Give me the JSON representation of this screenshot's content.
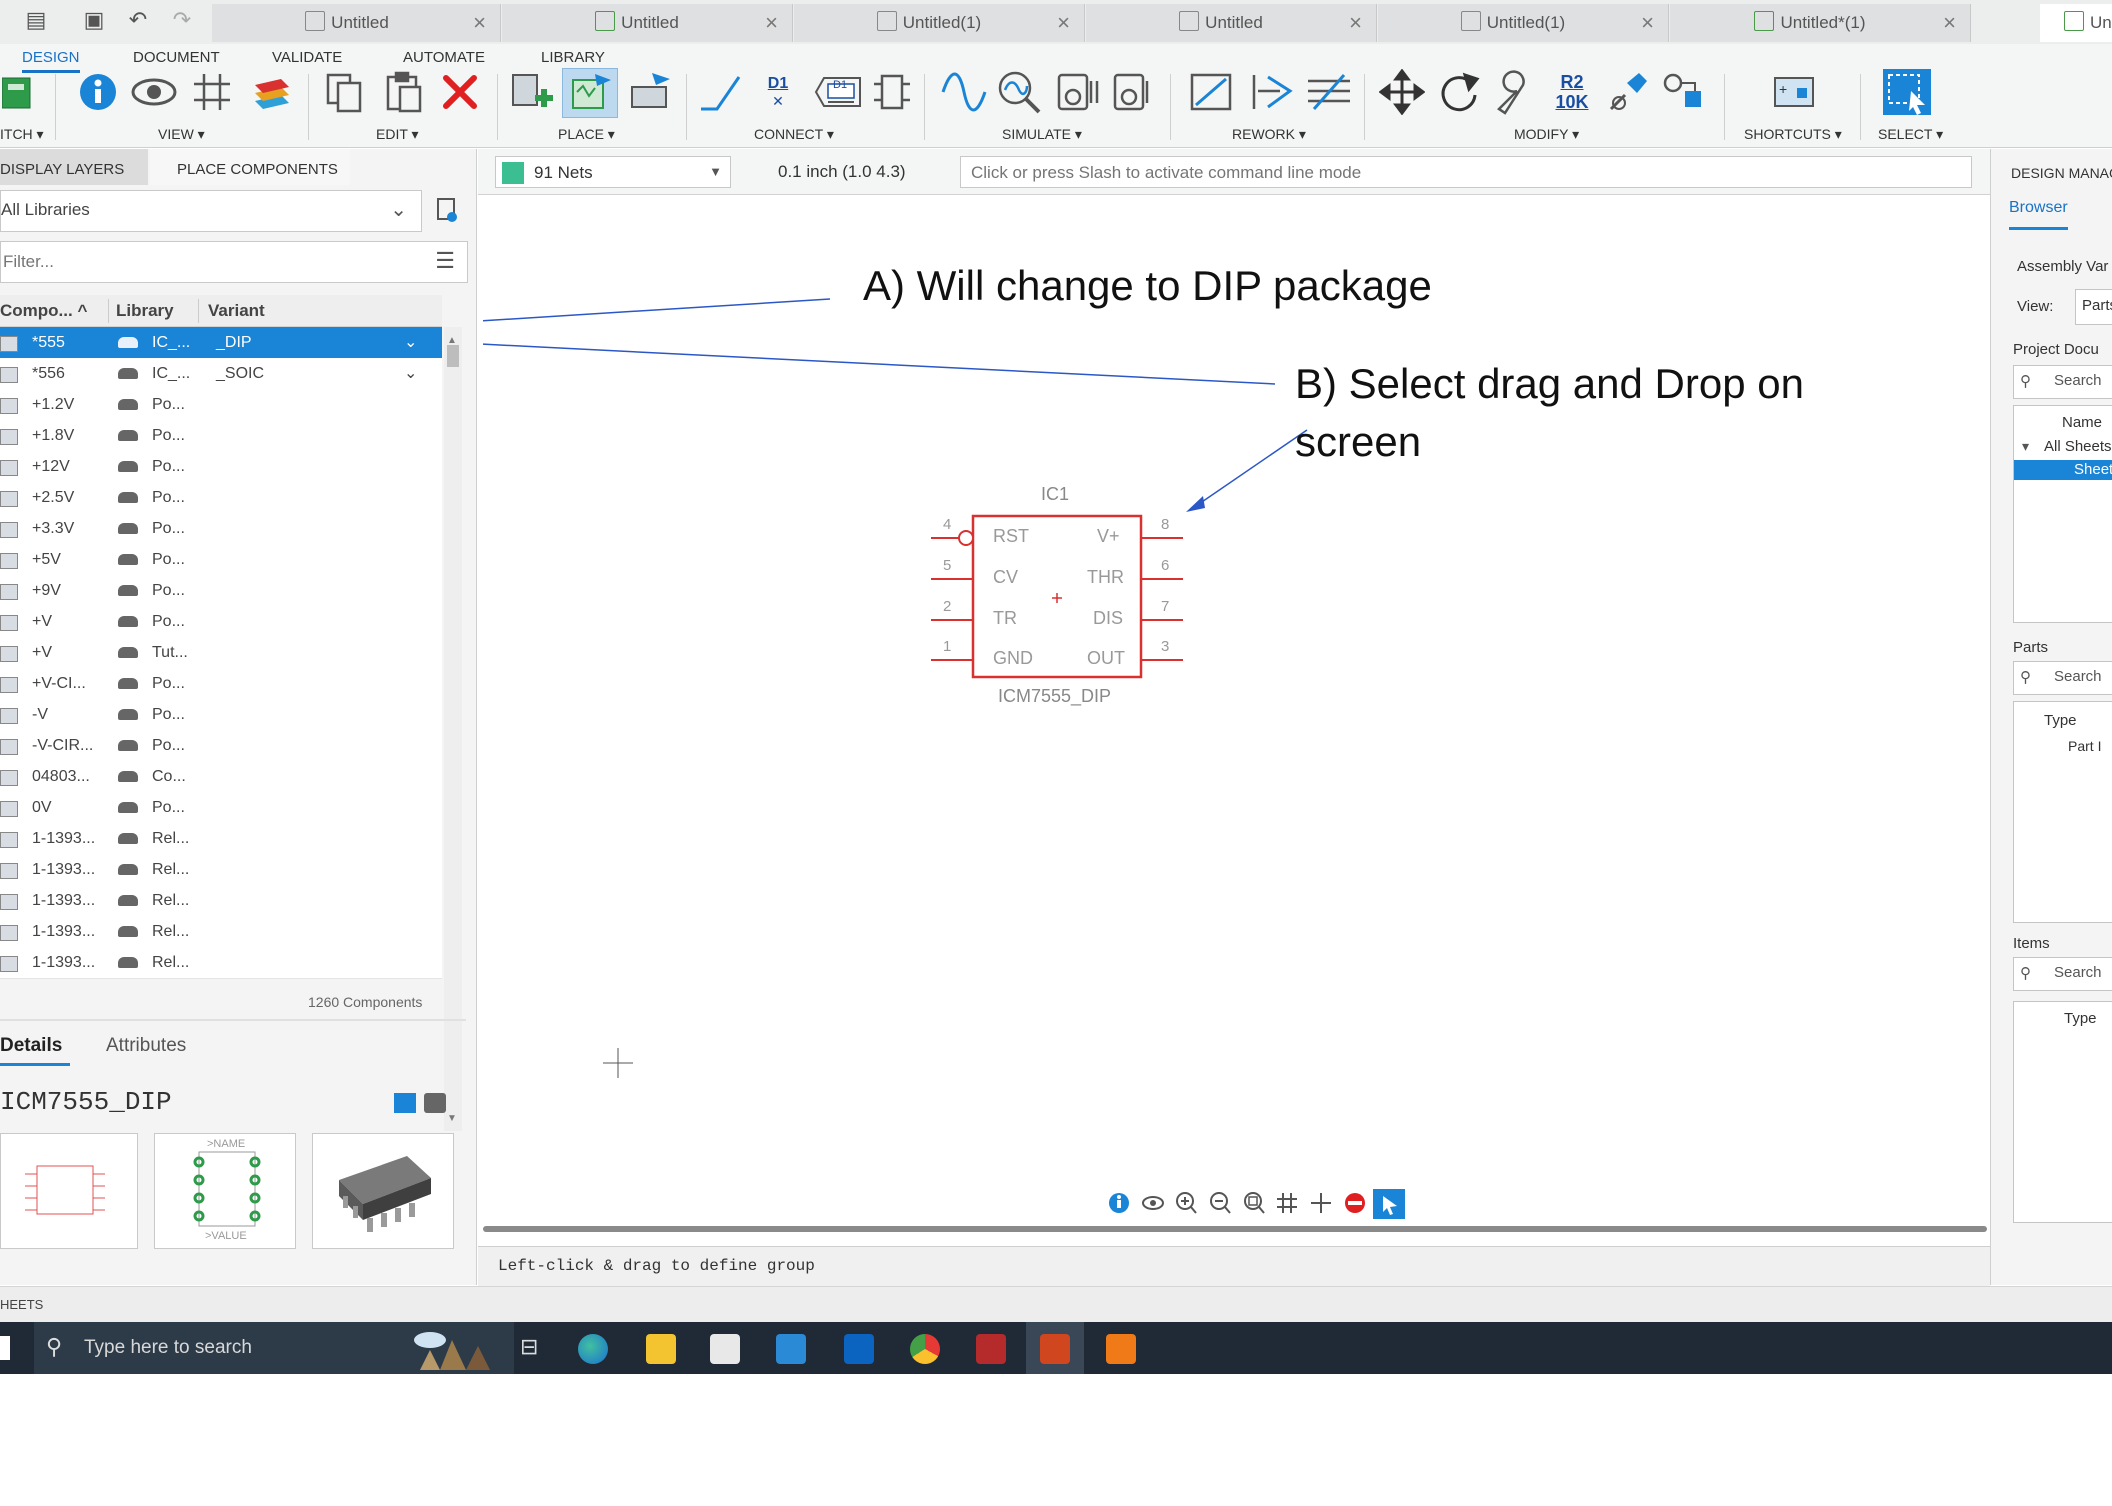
{
  "tabs": [
    {
      "label": "Untitled",
      "icon": "cube-icon"
    },
    {
      "label": "Untitled",
      "icon": "schematic-icon"
    },
    {
      "label": "Untitled(1)",
      "icon": "cube-icon"
    },
    {
      "label": "Untitled",
      "icon": "board-icon"
    },
    {
      "label": "Untitled(1)",
      "icon": "board-icon"
    },
    {
      "label": "Untitled*(1)",
      "icon": "schematic-icon"
    },
    {
      "label": "Unti",
      "icon": "schematic-icon"
    }
  ],
  "ribbon": {
    "tabs": [
      "DESIGN",
      "DOCUMENT",
      "VALIDATE",
      "AUTOMATE",
      "LIBRARY"
    ],
    "groups": [
      "ITCH ▾",
      "VIEW ▾",
      "EDIT ▾",
      "PLACE ▾",
      "CONNECT ▾",
      "SIMULATE ▾",
      "REWORK ▾",
      "MODIFY ▾",
      "SHORTCUTS ▾",
      "SELECT ▾"
    ],
    "d1_label": "D1",
    "d1_box_label": "D1",
    "r2_label": "R2",
    "r2_value": "10K"
  },
  "left_panel": {
    "tabs": [
      "DISPLAY LAYERS",
      "PLACE COMPONENTS"
    ],
    "library_select": "All Libraries",
    "filter_placeholder": "Filter...",
    "columns": [
      "Compo... ^",
      "Library",
      "Variant"
    ],
    "rows": [
      {
        "name": "*555",
        "lib": "IC_...",
        "variant": "_DIP",
        "selected": true
      },
      {
        "name": "*556",
        "lib": "IC_...",
        "variant": "_SOIC"
      },
      {
        "name": "+1.2V",
        "lib": "Po...",
        "variant": ""
      },
      {
        "name": "+1.8V",
        "lib": "Po...",
        "variant": ""
      },
      {
        "name": "+12V",
        "lib": "Po...",
        "variant": ""
      },
      {
        "name": "+2.5V",
        "lib": "Po...",
        "variant": ""
      },
      {
        "name": "+3.3V",
        "lib": "Po...",
        "variant": ""
      },
      {
        "name": "+5V",
        "lib": "Po...",
        "variant": ""
      },
      {
        "name": "+9V",
        "lib": "Po...",
        "variant": ""
      },
      {
        "name": "+V",
        "lib": "Po...",
        "variant": ""
      },
      {
        "name": "+V",
        "lib": "Tut...",
        "variant": ""
      },
      {
        "name": "+V-CI...",
        "lib": "Po...",
        "variant": ""
      },
      {
        "name": "-V",
        "lib": "Po...",
        "variant": ""
      },
      {
        "name": "-V-CIR...",
        "lib": "Po...",
        "variant": ""
      },
      {
        "name": "04803...",
        "lib": "Co...",
        "variant": ""
      },
      {
        "name": "0V",
        "lib": "Po...",
        "variant": ""
      },
      {
        "name": "1-1393...",
        "lib": "Rel...",
        "variant": ""
      },
      {
        "name": "1-1393...",
        "lib": "Rel...",
        "variant": ""
      },
      {
        "name": "1-1393...",
        "lib": "Rel...",
        "variant": ""
      },
      {
        "name": "1-1393...",
        "lib": "Rel...",
        "variant": ""
      },
      {
        "name": "1-1393...",
        "lib": "Rel...",
        "variant": ""
      }
    ],
    "component_count": "1260 Components",
    "detail_tabs": [
      "Details",
      "Attributes"
    ],
    "detail_name": "ICM7555_DIP",
    "thumb_name": ">NAME",
    "thumb_value": ">VALUE"
  },
  "toolbar2": {
    "net_select": "91 Nets",
    "grid_readout": "0.1 inch (1.0 4.3)",
    "command_placeholder": "Click or press Slash to activate command line mode"
  },
  "schematic": {
    "ref": "IC1",
    "value": "ICM7555_DIP",
    "left_pins": [
      {
        "num": "4",
        "name": "RST"
      },
      {
        "num": "5",
        "name": "CV"
      },
      {
        "num": "2",
        "name": "TR"
      },
      {
        "num": "1",
        "name": "GND"
      }
    ],
    "right_pins": [
      {
        "num": "8",
        "name": "V+"
      },
      {
        "num": "6",
        "name": "THR"
      },
      {
        "num": "7",
        "name": "DIS"
      },
      {
        "num": "3",
        "name": "OUT"
      }
    ]
  },
  "annotations": {
    "a": "A) Will change to DIP package",
    "b_line1": "B) Select drag and Drop  on",
    "b_line2": "screen"
  },
  "status_text": "Left-click & drag to define group",
  "sheets_label": "HEETS",
  "right_panel": {
    "title": "DESIGN MANAG",
    "tab": "Browser",
    "assembly": "Assembly Var",
    "view_label": "View:",
    "view_value": "Parts",
    "project_docs": "Project Docu",
    "search": "Search",
    "name_col": "Name",
    "all_sheets": "All Sheets",
    "sheet": "Sheet",
    "parts": "Parts",
    "type_col": "Type",
    "part_row": "Part I",
    "items": "Items"
  },
  "taskbar": {
    "search_placeholder": "Type here to search"
  },
  "colors": {
    "accent": "#1a72c6",
    "selection": "#1a84d6",
    "schematic_red": "#d93030",
    "annotation_line": "#2b57c7"
  }
}
